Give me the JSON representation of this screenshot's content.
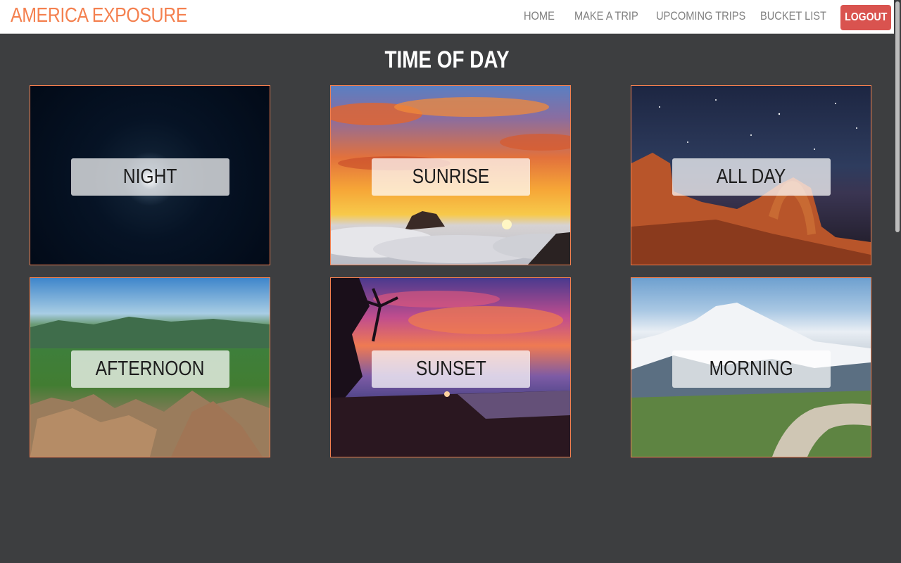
{
  "navbar": {
    "brand": "AMERICA EXPOSURE",
    "items": [
      {
        "label": "HOME"
      },
      {
        "label": "MAKE A TRIP"
      },
      {
        "label": "UPCOMING TRIPS"
      },
      {
        "label": "BUCKET LIST"
      }
    ],
    "logout_label": "LOGOUT"
  },
  "page": {
    "title": "TIME OF DAY"
  },
  "cards": [
    {
      "label": "NIGHT"
    },
    {
      "label": "SUNRISE"
    },
    {
      "label": "ALL DAY"
    },
    {
      "label": "AFTERNOON"
    },
    {
      "label": "SUNSET"
    },
    {
      "label": "MORNING"
    }
  ],
  "colors": {
    "accent": "#f4804f",
    "background": "#3d3e40",
    "logout": "#d9534f"
  }
}
